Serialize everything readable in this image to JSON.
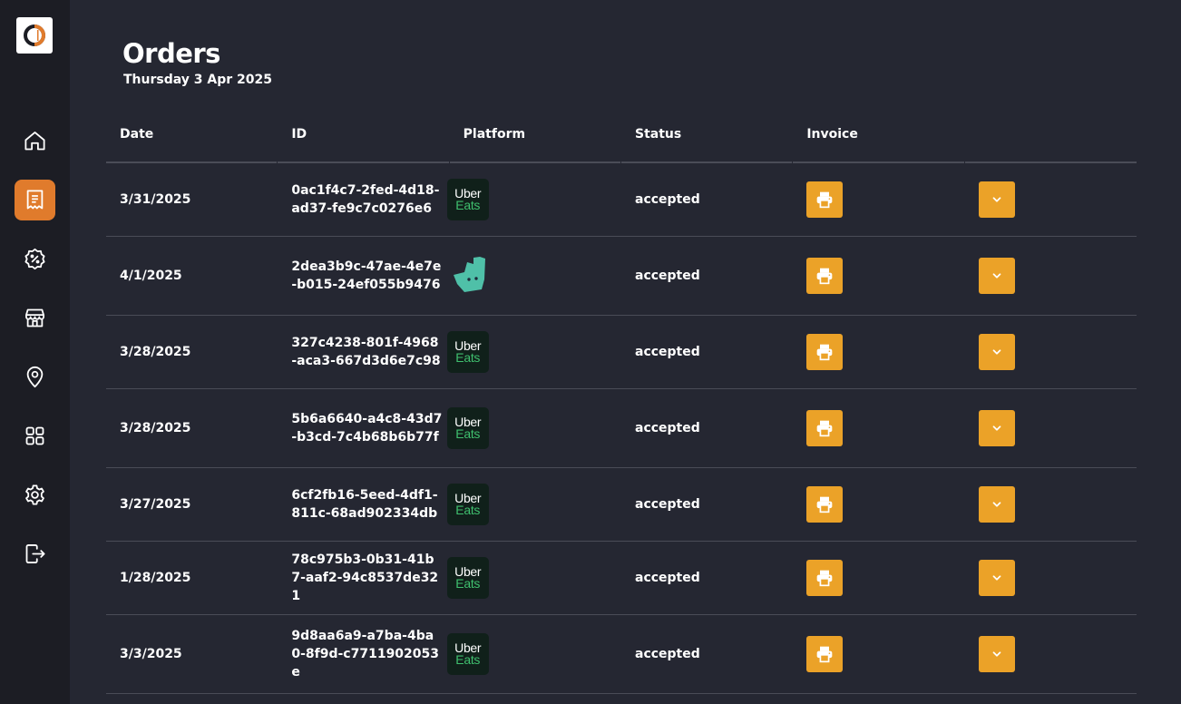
{
  "page": {
    "title": "Orders",
    "date": "Thursday 3 Apr 2025"
  },
  "sidebar": {
    "items": [
      {
        "name": "home-icon",
        "active": false
      },
      {
        "name": "orders-icon",
        "active": true
      },
      {
        "name": "discount-icon",
        "active": false
      },
      {
        "name": "store-icon",
        "active": false
      },
      {
        "name": "location-icon",
        "active": false
      },
      {
        "name": "apps-grid-icon",
        "active": false
      },
      {
        "name": "settings-icon",
        "active": false
      },
      {
        "name": "logout-icon",
        "active": false
      }
    ],
    "active_color": "#e07b2c"
  },
  "table": {
    "columns": [
      "Date",
      "ID",
      "Platform",
      "Status",
      "Invoice",
      ""
    ],
    "rows": [
      {
        "date": "3/31/2025",
        "id": "0ac1f4c7-2fed-4d18-ad37-fe9c7c0276e6",
        "platform": "uber-eats",
        "status": "accepted"
      },
      {
        "date": "4/1/2025",
        "id": "2dea3b9c-47ae-4e7e-b015-24ef055b9476",
        "platform": "deliveroo",
        "status": "accepted"
      },
      {
        "date": "3/28/2025",
        "id": "327c4238-801f-4968-aca3-667d3d6e7c98",
        "platform": "uber-eats",
        "status": "accepted"
      },
      {
        "date": "3/28/2025",
        "id": "5b6a6640-a4c8-43d7-b3cd-7c4b68b6b77f",
        "platform": "uber-eats",
        "status": "accepted"
      },
      {
        "date": "3/27/2025",
        "id": "6cf2fb16-5eed-4df1-811c-68ad902334db",
        "platform": "uber-eats",
        "status": "accepted"
      },
      {
        "date": "1/28/2025",
        "id": "78c975b3-0b31-41b7-aaf2-94c8537de321",
        "platform": "uber-eats",
        "status": "accepted"
      },
      {
        "date": "3/3/2025",
        "id": "9d8aa6a9-a7ba-4ba0-8f9d-c7711902053e",
        "platform": "uber-eats",
        "status": "accepted"
      }
    ]
  },
  "uber_eats_logo": {
    "line1": "Uber",
    "line2": "Eats"
  },
  "colors": {
    "background": "#252732",
    "sidebar": "#1c1d24",
    "button": "#eba228",
    "uber_green": "#3fbf6e",
    "deliveroo": "#4fc0a8"
  }
}
